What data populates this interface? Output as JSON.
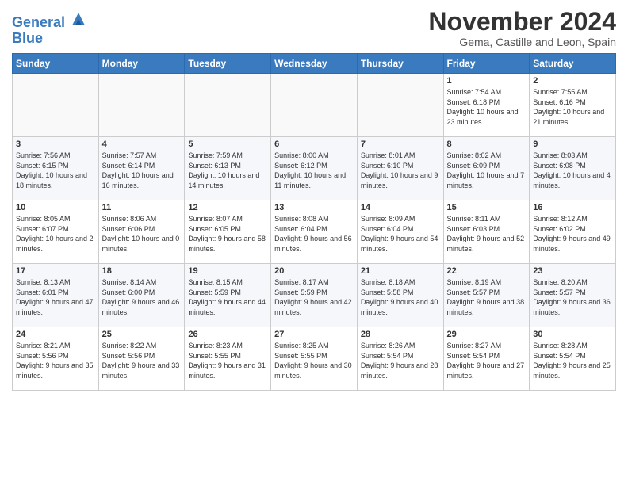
{
  "header": {
    "logo_line1": "General",
    "logo_line2": "Blue",
    "month_title": "November 2024",
    "subtitle": "Gema, Castille and Leon, Spain"
  },
  "weekdays": [
    "Sunday",
    "Monday",
    "Tuesday",
    "Wednesday",
    "Thursday",
    "Friday",
    "Saturday"
  ],
  "weeks": [
    [
      {
        "day": "",
        "info": ""
      },
      {
        "day": "",
        "info": ""
      },
      {
        "day": "",
        "info": ""
      },
      {
        "day": "",
        "info": ""
      },
      {
        "day": "",
        "info": ""
      },
      {
        "day": "1",
        "info": "Sunrise: 7:54 AM\nSunset: 6:18 PM\nDaylight: 10 hours and 23 minutes."
      },
      {
        "day": "2",
        "info": "Sunrise: 7:55 AM\nSunset: 6:16 PM\nDaylight: 10 hours and 21 minutes."
      }
    ],
    [
      {
        "day": "3",
        "info": "Sunrise: 7:56 AM\nSunset: 6:15 PM\nDaylight: 10 hours and 18 minutes."
      },
      {
        "day": "4",
        "info": "Sunrise: 7:57 AM\nSunset: 6:14 PM\nDaylight: 10 hours and 16 minutes."
      },
      {
        "day": "5",
        "info": "Sunrise: 7:59 AM\nSunset: 6:13 PM\nDaylight: 10 hours and 14 minutes."
      },
      {
        "day": "6",
        "info": "Sunrise: 8:00 AM\nSunset: 6:12 PM\nDaylight: 10 hours and 11 minutes."
      },
      {
        "day": "7",
        "info": "Sunrise: 8:01 AM\nSunset: 6:10 PM\nDaylight: 10 hours and 9 minutes."
      },
      {
        "day": "8",
        "info": "Sunrise: 8:02 AM\nSunset: 6:09 PM\nDaylight: 10 hours and 7 minutes."
      },
      {
        "day": "9",
        "info": "Sunrise: 8:03 AM\nSunset: 6:08 PM\nDaylight: 10 hours and 4 minutes."
      }
    ],
    [
      {
        "day": "10",
        "info": "Sunrise: 8:05 AM\nSunset: 6:07 PM\nDaylight: 10 hours and 2 minutes."
      },
      {
        "day": "11",
        "info": "Sunrise: 8:06 AM\nSunset: 6:06 PM\nDaylight: 10 hours and 0 minutes."
      },
      {
        "day": "12",
        "info": "Sunrise: 8:07 AM\nSunset: 6:05 PM\nDaylight: 9 hours and 58 minutes."
      },
      {
        "day": "13",
        "info": "Sunrise: 8:08 AM\nSunset: 6:04 PM\nDaylight: 9 hours and 56 minutes."
      },
      {
        "day": "14",
        "info": "Sunrise: 8:09 AM\nSunset: 6:04 PM\nDaylight: 9 hours and 54 minutes."
      },
      {
        "day": "15",
        "info": "Sunrise: 8:11 AM\nSunset: 6:03 PM\nDaylight: 9 hours and 52 minutes."
      },
      {
        "day": "16",
        "info": "Sunrise: 8:12 AM\nSunset: 6:02 PM\nDaylight: 9 hours and 49 minutes."
      }
    ],
    [
      {
        "day": "17",
        "info": "Sunrise: 8:13 AM\nSunset: 6:01 PM\nDaylight: 9 hours and 47 minutes."
      },
      {
        "day": "18",
        "info": "Sunrise: 8:14 AM\nSunset: 6:00 PM\nDaylight: 9 hours and 46 minutes."
      },
      {
        "day": "19",
        "info": "Sunrise: 8:15 AM\nSunset: 5:59 PM\nDaylight: 9 hours and 44 minutes."
      },
      {
        "day": "20",
        "info": "Sunrise: 8:17 AM\nSunset: 5:59 PM\nDaylight: 9 hours and 42 minutes."
      },
      {
        "day": "21",
        "info": "Sunrise: 8:18 AM\nSunset: 5:58 PM\nDaylight: 9 hours and 40 minutes."
      },
      {
        "day": "22",
        "info": "Sunrise: 8:19 AM\nSunset: 5:57 PM\nDaylight: 9 hours and 38 minutes."
      },
      {
        "day": "23",
        "info": "Sunrise: 8:20 AM\nSunset: 5:57 PM\nDaylight: 9 hours and 36 minutes."
      }
    ],
    [
      {
        "day": "24",
        "info": "Sunrise: 8:21 AM\nSunset: 5:56 PM\nDaylight: 9 hours and 35 minutes."
      },
      {
        "day": "25",
        "info": "Sunrise: 8:22 AM\nSunset: 5:56 PM\nDaylight: 9 hours and 33 minutes."
      },
      {
        "day": "26",
        "info": "Sunrise: 8:23 AM\nSunset: 5:55 PM\nDaylight: 9 hours and 31 minutes."
      },
      {
        "day": "27",
        "info": "Sunrise: 8:25 AM\nSunset: 5:55 PM\nDaylight: 9 hours and 30 minutes."
      },
      {
        "day": "28",
        "info": "Sunrise: 8:26 AM\nSunset: 5:54 PM\nDaylight: 9 hours and 28 minutes."
      },
      {
        "day": "29",
        "info": "Sunrise: 8:27 AM\nSunset: 5:54 PM\nDaylight: 9 hours and 27 minutes."
      },
      {
        "day": "30",
        "info": "Sunrise: 8:28 AM\nSunset: 5:54 PM\nDaylight: 9 hours and 25 minutes."
      }
    ]
  ]
}
